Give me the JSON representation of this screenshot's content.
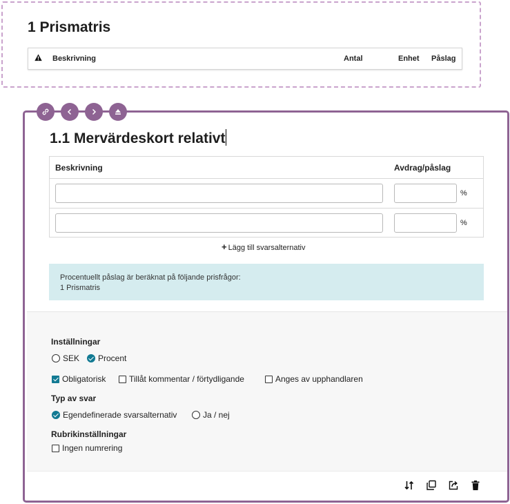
{
  "prismatris": {
    "title": "1 Prismatris",
    "columns": {
      "beskrivning": "Beskrivning",
      "antal": "Antal",
      "enhet": "Enhet",
      "paslag": "Påslag"
    },
    "warning_icon": "warning-icon"
  },
  "question": {
    "title": "1.1 Mervärdeskort relativt",
    "toolbar": [
      "link-icon",
      "chevron-left-icon",
      "chevron-right-icon",
      "eject-icon"
    ],
    "table": {
      "col_description": "Beskrivning",
      "col_adjustment": "Avdrag/påslag",
      "rows": [
        {
          "description": "",
          "percent": "",
          "unit": "%"
        },
        {
          "description": "",
          "percent": "",
          "unit": "%"
        }
      ]
    },
    "add_alternative": "Lägg till svarsalternativ",
    "info": {
      "line1": "Procentuellt påslag är beräknat på följande prisfrågor:",
      "line2": "1 Prismatris"
    },
    "settings": {
      "heading": "Inställningar",
      "currency_sek": "SEK",
      "currency_procent": "Procent",
      "selected_unit": "Procent",
      "mandatory": "Obligatorisk",
      "allow_comment": "Tillåt kommentar / förtydligande",
      "set_by_buyer": "Anges av upphandlaren",
      "mandatory_checked": true,
      "answer_type_heading": "Typ av svar",
      "custom_answers": "Egendefinerade svarsalternativ",
      "yes_no": "Ja / nej",
      "selected_answer_type": "Egendefinerade svarsalternativ",
      "heading_settings": "Rubrikinställningar",
      "no_numbering": "Ingen numrering"
    },
    "actions": [
      "sort-icon",
      "copy-icon",
      "share-icon",
      "trash-icon"
    ]
  },
  "colors": {
    "accent": "#8e6393",
    "check": "#127a93",
    "info_bg": "#d5ecef"
  }
}
